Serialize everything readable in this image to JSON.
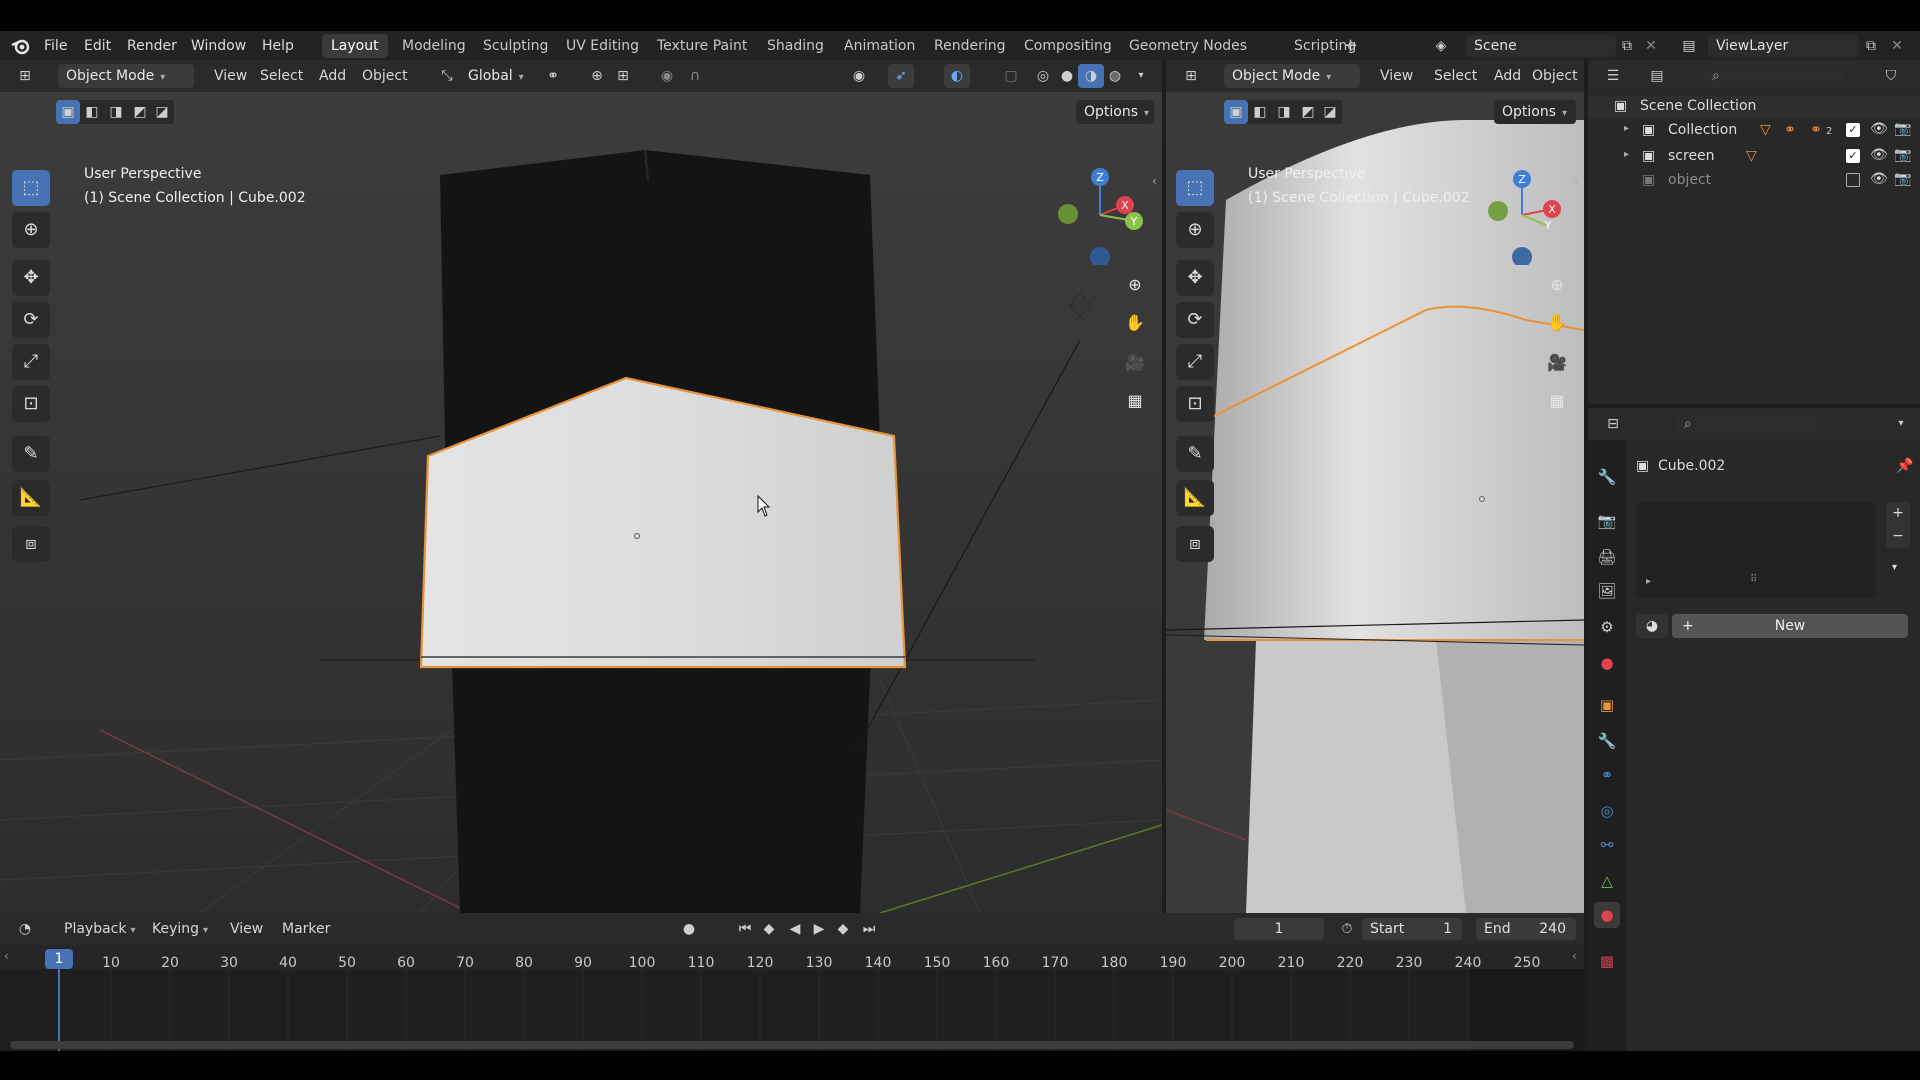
{
  "menubar": {
    "logo": "blender-logo-icon",
    "menus": [
      "File",
      "Edit",
      "Render",
      "Window",
      "Help"
    ],
    "workspaces": [
      "Layout",
      "Modeling",
      "Sculpting",
      "UV Editing",
      "Texture Paint",
      "Shading",
      "Animation",
      "Rendering",
      "Compositing",
      "Geometry Nodes",
      "Scripting"
    ],
    "add_tab": "+",
    "scene_label": "Scene",
    "viewlayer_label": "ViewLayer"
  },
  "viewport_left": {
    "mode": "Object Mode",
    "menus": [
      "View",
      "Select",
      "Add",
      "Object"
    ],
    "transform_orientation": "Global",
    "options_label": "Options",
    "info_line1": "User Perspective",
    "info_line2": "(1) Scene Collection | Cube.002"
  },
  "viewport_right": {
    "mode": "Object Mode",
    "menus": [
      "View",
      "Select",
      "Add",
      "Object"
    ],
    "options_label": "Options",
    "info_line1": "User Perspective",
    "info_line2": "(1) Scene Collection | Cube.002"
  },
  "gizmo": {
    "z": "Z",
    "x": "X",
    "y": "Y"
  },
  "outliner": {
    "root": "Scene Collection",
    "items": [
      {
        "label": "Collection",
        "expanded": false,
        "checked": true
      },
      {
        "label": "screen",
        "expanded": false,
        "checked": true
      },
      {
        "label": "object",
        "checked": false,
        "dimmed": true
      }
    ],
    "badge": "2"
  },
  "properties": {
    "object_name": "Cube.002",
    "new_label": "New"
  },
  "timeline": {
    "menus": [
      "Playback",
      "Keying",
      "View",
      "Marker"
    ],
    "current_frame": "1",
    "start_label": "Start",
    "start_value": "1",
    "end_label": "End",
    "end_value": "240",
    "ruler_current": "1",
    "ticks": [
      "10",
      "20",
      "30",
      "40",
      "50",
      "60",
      "70",
      "80",
      "90",
      "100",
      "110",
      "120",
      "130",
      "140",
      "150",
      "160",
      "170",
      "180",
      "190",
      "200",
      "210",
      "220",
      "230",
      "240",
      "250"
    ]
  },
  "colors": {
    "accent": "#4772b3",
    "selection_outline": "#e8923a",
    "axis_x": "#e0424e",
    "axis_y": "#8bc34a",
    "axis_z": "#3d7fd6"
  }
}
